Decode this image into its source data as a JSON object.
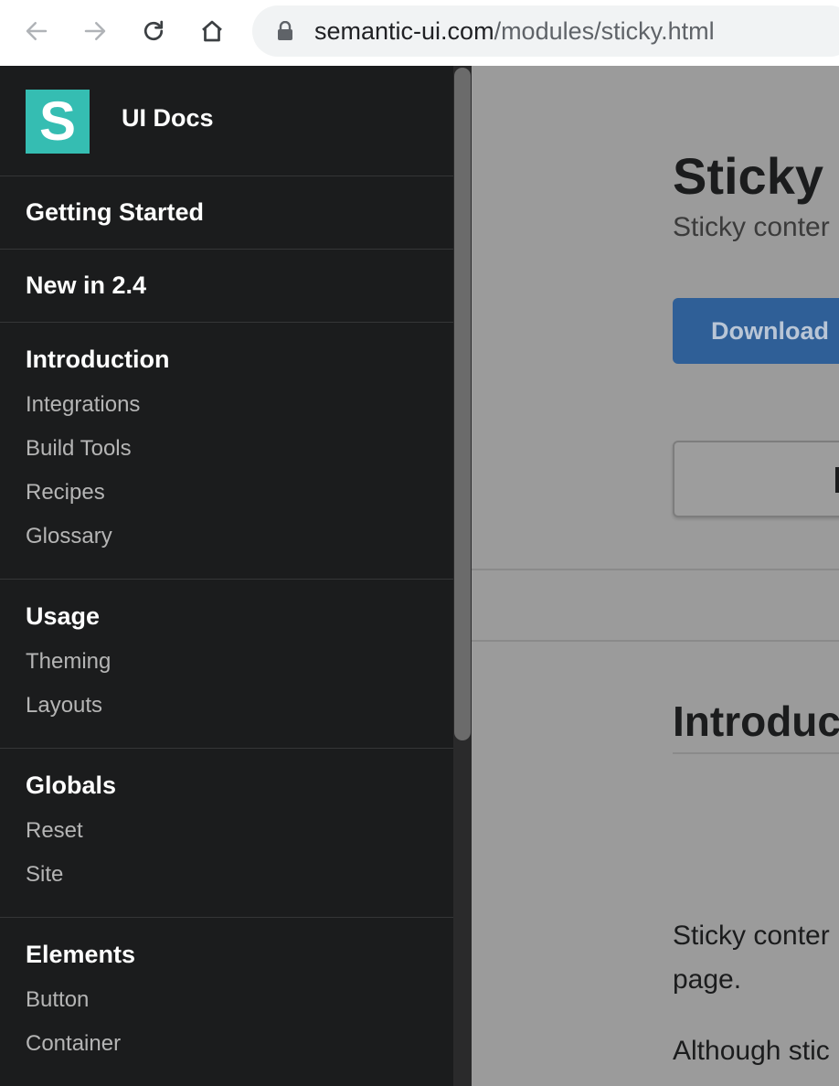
{
  "browser": {
    "url_domain": "semantic-ui.com",
    "url_path": "/modules/sticky.html"
  },
  "sidebar": {
    "brand_letter": "S",
    "brand_title": "UI Docs",
    "logo_color": "#35bdb2",
    "items": [
      {
        "label": "Getting Started"
      },
      {
        "label": "New in 2.4"
      }
    ],
    "groups": [
      {
        "header": "Introduction",
        "items": [
          "Integrations",
          "Build Tools",
          "Recipes",
          "Glossary"
        ]
      },
      {
        "header": "Usage",
        "items": [
          "Theming",
          "Layouts"
        ]
      },
      {
        "header": "Globals",
        "items": [
          "Reset",
          "Site"
        ]
      },
      {
        "header": "Elements",
        "items": [
          "Button",
          "Container"
        ]
      }
    ]
  },
  "main": {
    "title": "Sticky",
    "subtitle": "Sticky conter",
    "download_label": "Download",
    "download_color": "#2f5f97",
    "section_title": "Introduct",
    "para1_line1": "Sticky conter",
    "para1_line2": "page.",
    "para2_line1": "Although stic"
  }
}
